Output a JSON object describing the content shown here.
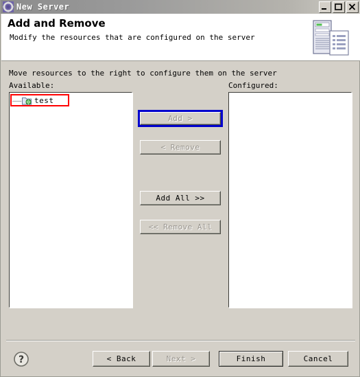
{
  "window": {
    "title": "New Server",
    "title_icon": "server-gear-icon",
    "controls": [
      {
        "name": "minimize-button",
        "glyph": "minimize-icon"
      },
      {
        "name": "maximize-button",
        "glyph": "maximize-icon"
      },
      {
        "name": "close-button",
        "glyph": "close-icon"
      }
    ]
  },
  "banner": {
    "title": "Add and Remove",
    "subtitle": "Modify the resources that are configured on the server",
    "icon": "server-and-document-icon"
  },
  "body": {
    "instruction": "Move resources to the right to configure them on the server",
    "available_label": "Available:",
    "configured_label": "Configured:",
    "available_items": [
      {
        "label": "test",
        "icon": "web-project-icon",
        "tree_prefix": "——"
      }
    ],
    "configured_items": []
  },
  "transfer_buttons": [
    {
      "name": "add-button",
      "label": "Add >",
      "enabled": false,
      "highlighted": true
    },
    {
      "name": "remove-button",
      "label": "< Remove",
      "enabled": false,
      "highlighted": false
    },
    {
      "name": "add-all-button",
      "label": "Add All >>",
      "enabled": true,
      "highlighted": false
    },
    {
      "name": "remove-all-button",
      "label": "<< Remove All",
      "enabled": false,
      "highlighted": false
    }
  ],
  "footer": {
    "help_icon": "help-question-icon",
    "back_label": "< Back",
    "next_label": "Next >",
    "finish_label": "Finish",
    "cancel_label": "Cancel"
  },
  "colors": {
    "dialog_background": "#d4d0c8",
    "banner_background": "#ffffff",
    "annotation_red": "#ff0000",
    "annotation_blue": "#0000cd",
    "disabled_text": "#9a968f",
    "titlebar_gradient_start": "#8c8c8c",
    "titlebar_gradient_end": "#cfcdc6"
  }
}
